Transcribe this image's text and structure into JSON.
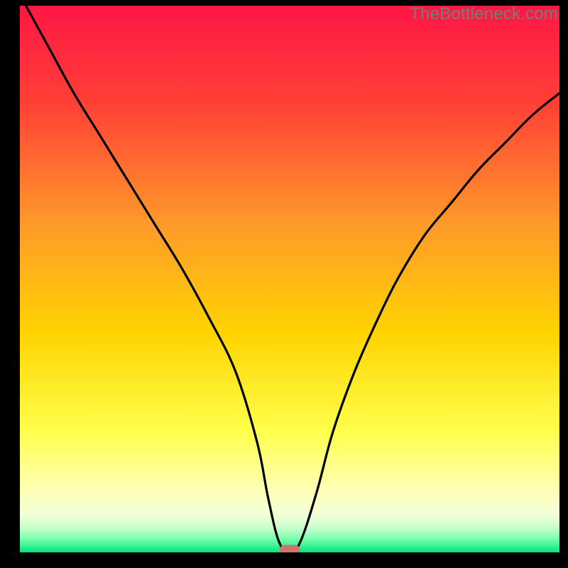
{
  "attribution": "TheBottleneck.com",
  "colors": {
    "top": "#ff1745",
    "upper_mid": "#ff6a2f",
    "mid": "#ffd400",
    "lower_mid": "#ffff66",
    "pale": "#fdffd0",
    "green_pale": "#b8ffc0",
    "green": "#00e57f",
    "curve": "#000000",
    "marker": "#d0736b",
    "page_bg": "#000000"
  },
  "chart_data": {
    "type": "line",
    "title": "",
    "xlabel": "",
    "ylabel": "",
    "xlim": [
      0,
      100
    ],
    "ylim": [
      0,
      100
    ],
    "series": [
      {
        "name": "bottleneck-curve",
        "x": [
          0,
          5,
          10,
          15,
          20,
          25,
          30,
          35,
          40,
          44,
          46,
          48,
          50,
          52,
          55,
          58,
          62,
          66,
          70,
          75,
          80,
          85,
          90,
          95,
          100
        ],
        "y": [
          102,
          93,
          84,
          76,
          68,
          60,
          52,
          43,
          33,
          20,
          10,
          2,
          0,
          2,
          11,
          22,
          33,
          42,
          50,
          58,
          64,
          70,
          75,
          80,
          84
        ]
      }
    ],
    "marker": {
      "x": 50,
      "y": 0,
      "shape": "pill"
    }
  }
}
